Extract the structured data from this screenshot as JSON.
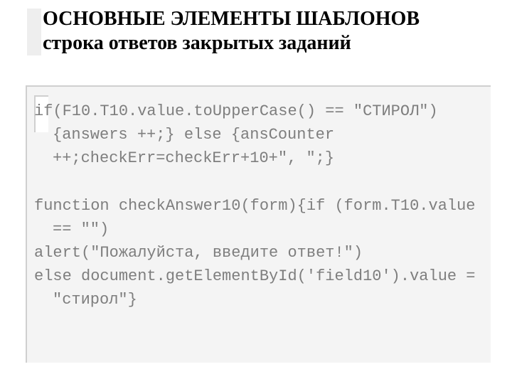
{
  "title": {
    "line1": "ОСНОВНЫЕ ЭЛЕМЕНТЫ ШАБЛОНОВ",
    "line2": "строка ответов закрытых заданий"
  },
  "code": {
    "p1": "if(F10.T10.value.toUpperCase() == ″СТИРОЛ\") {answers ++;} else {ansCounter ++;checkErr=checkErr+10+\", \";}",
    "p2": "function checkAnswer10(form){if (form.T10.value == \"\")",
    "p3": "alert(\"Пожалуйста, введите ответ!\")",
    "p4": "else document.getElementById('field10').value = \"стирол\"}"
  }
}
